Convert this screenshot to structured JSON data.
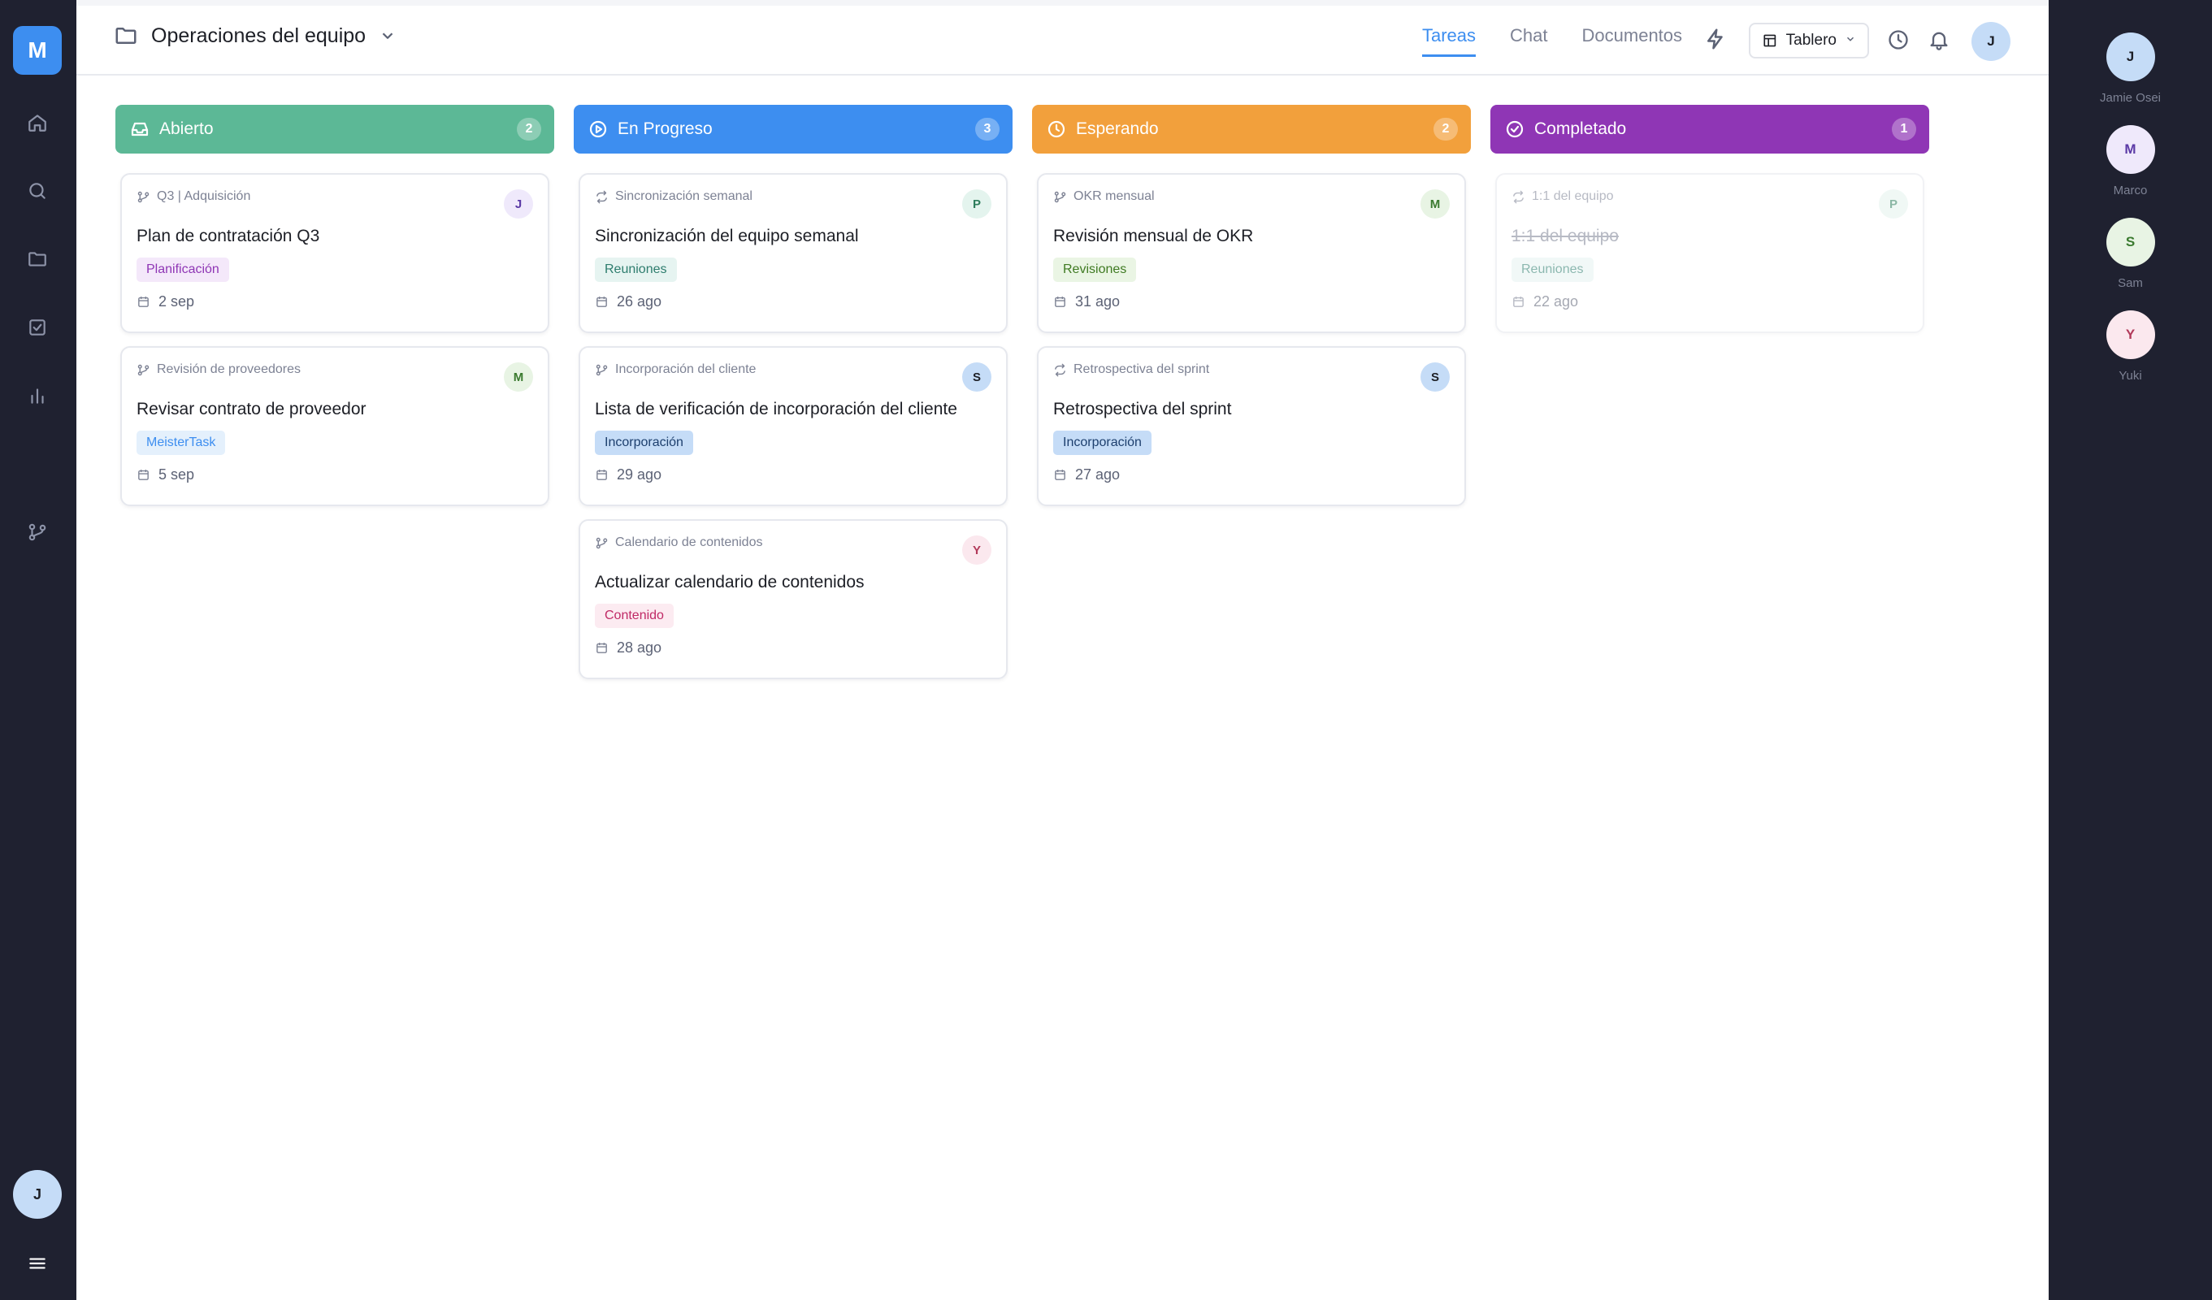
{
  "app": {
    "logo_letter": "M",
    "user_initial": "J"
  },
  "nav": {
    "items": [
      {
        "icon": "home-icon"
      },
      {
        "icon": "search-icon"
      },
      {
        "icon": "folder-icon"
      },
      {
        "icon": "checkbox-icon"
      },
      {
        "icon": "bar-chart-icon"
      },
      {
        "icon": "git-branch-icon"
      }
    ],
    "menu_icon": "hamburger-menu-icon"
  },
  "header": {
    "project_name": "Operaciones del equipo",
    "tabs": [
      {
        "label": "Tareas",
        "active": true
      },
      {
        "label": "Chat",
        "active": false
      },
      {
        "label": "Documentos",
        "active": false
      }
    ],
    "view_label": "Tablero",
    "user_initial": "J"
  },
  "colors": {
    "open": "#5cb896",
    "progress": "#3d8ef0",
    "waiting": "#f2a03c",
    "done": "#8f36b5"
  },
  "columns": [
    {
      "title": "Abierto",
      "count": "2",
      "icon": "inbox-icon",
      "cards": [
        {
          "source": "Q3 | Adquisición",
          "source_icon": "git-branch-icon",
          "avatar": "J",
          "title": "Plan de contratación Q3",
          "tag": "Planificación",
          "date": "2 sep"
        },
        {
          "source": "Revisión de proveedores",
          "source_icon": "git-branch-icon",
          "avatar": "M",
          "title": "Revisar contrato de proveedor",
          "tag": "MeisterTask",
          "date": "5 sep"
        }
      ]
    },
    {
      "title": "En Progreso",
      "count": "3",
      "icon": "play-circle-icon",
      "cards": [
        {
          "source": "Sincronización semanal",
          "source_icon": "repeat-icon",
          "avatar": "P",
          "title": "Sincronización del equipo semanal",
          "tag": "Reuniones",
          "date": "26 ago"
        },
        {
          "source": "Incorporación del cliente",
          "source_icon": "git-branch-icon",
          "avatar": "S",
          "title": "Lista de verificación de incorporación del cliente",
          "tag": "Incorporación",
          "date": "29 ago"
        },
        {
          "source": "Calendario de contenidos",
          "source_icon": "git-branch-icon",
          "avatar": "Y",
          "title": "Actualizar calendario de contenidos",
          "tag": "Contenido",
          "date": "28 ago"
        }
      ]
    },
    {
      "title": "Esperando",
      "count": "2",
      "icon": "clock-icon",
      "cards": [
        {
          "source": "OKR mensual",
          "source_icon": "git-branch-icon",
          "avatar": "M",
          "title": "Revisión mensual de OKR",
          "tag": "Revisiones",
          "date": "31 ago"
        },
        {
          "source": "Retrospectiva del sprint",
          "source_icon": "repeat-icon",
          "avatar": "S",
          "title": "Retrospectiva del sprint",
          "tag": "Incorporación",
          "date": "27 ago"
        }
      ]
    },
    {
      "title": "Completado",
      "count": "1",
      "icon": "check-circle-icon",
      "cards": [
        {
          "source": "1:1 del equipo",
          "source_icon": "repeat-icon",
          "avatar": "P",
          "title": "1:1 del equipo",
          "tag": "Reuniones",
          "date": "22 ago"
        }
      ]
    }
  ],
  "members": [
    {
      "initial": "J",
      "name": "Jamie Osei"
    },
    {
      "initial": "M",
      "name": "Marco"
    },
    {
      "initial": "S",
      "name": "Sam"
    },
    {
      "initial": "Y",
      "name": "Yuki"
    }
  ]
}
